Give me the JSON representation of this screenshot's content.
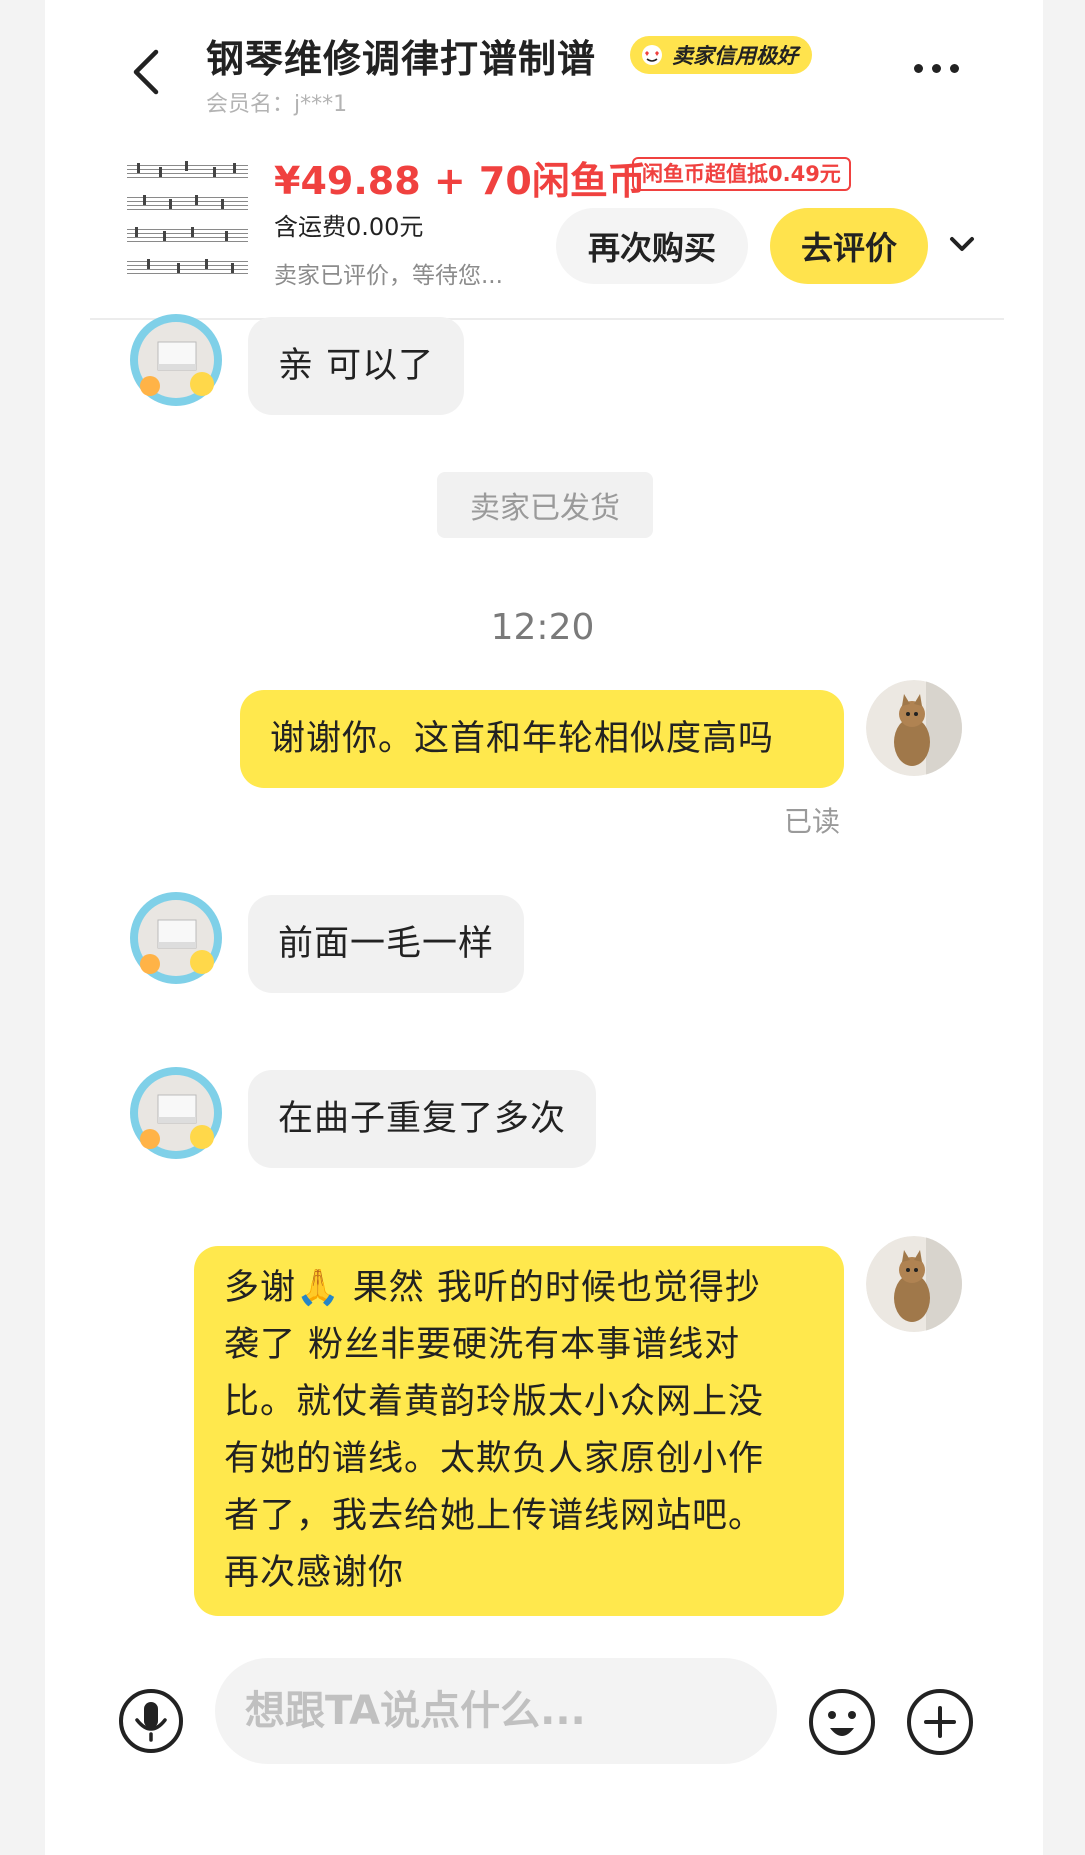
{
  "header": {
    "title": "钢琴维修调律打谱制谱",
    "credit_badge": "卖家信用极好",
    "member_label": "会员名：j***1"
  },
  "product": {
    "price": "¥49.88 + 70闲鱼币",
    "coin_tag": "闲鱼币超值抵0.49元",
    "shipping": "含运费0.00元",
    "status_snippet": "卖家已评价，等待您...",
    "rebuy_label": "再次购买",
    "review_label": "去评价"
  },
  "messages": {
    "m1": "亲 可以了",
    "system": "卖家已发货",
    "time": "12:20",
    "m2": "谢谢你。这首和年轮相似度高吗",
    "read": "已读",
    "m3": "前面一毛一样",
    "m4": "在曲子重复了多次",
    "m5_lines": [
      "多谢🙏 果然 我听的时候也觉得抄",
      "袭了 粉丝非要硬洗有本事谱线对",
      "比。就仗着黄韵玲版太小众网上没",
      "有她的谱线。太欺负人家原创小作",
      "者了，我去给她上传谱线网站吧。",
      "再次感谢你"
    ]
  },
  "input": {
    "placeholder": "想跟TA说点什么..."
  },
  "icons": {
    "back": "chevron-left-icon",
    "more": "more-dots-icon",
    "expand": "chevron-down-icon",
    "voice": "microphone-icon",
    "emoji": "emoji-icon",
    "add": "plus-icon"
  },
  "colors": {
    "accent_yellow": "#ffe34d",
    "price_red": "#f0413f"
  }
}
